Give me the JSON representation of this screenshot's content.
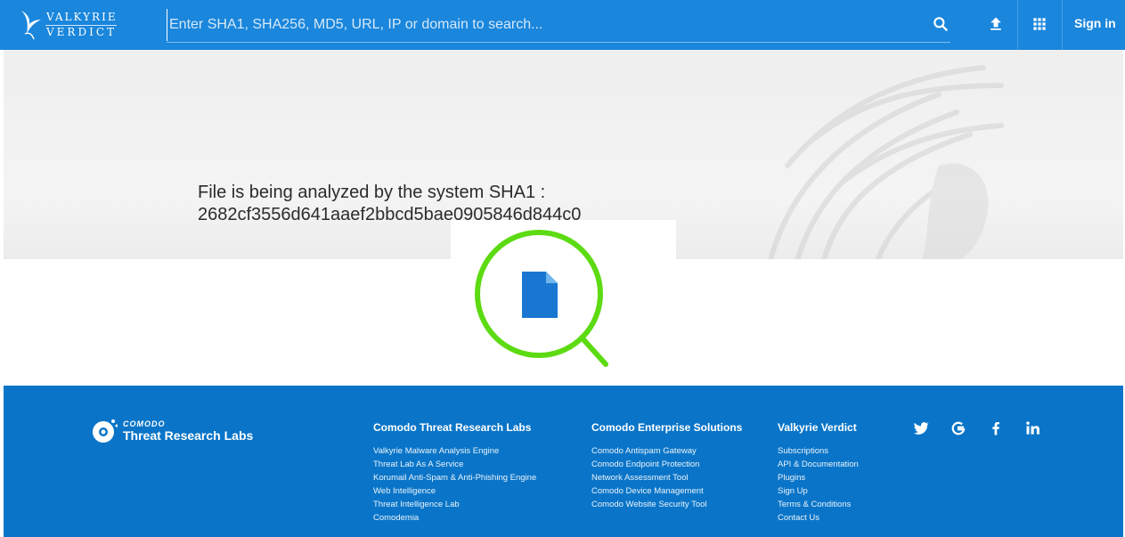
{
  "header": {
    "logo_line1": "VALKYRIE",
    "logo_line2": "VERDICT",
    "search_placeholder": "Enter SHA1, SHA256, MD5, URL, IP or domain to search...",
    "icons": [
      "search-icon",
      "upload-icon",
      "apps-grid-icon"
    ],
    "signin_label": "Sign in",
    "bg_color": "#1a86dc"
  },
  "main": {
    "message_line1": "File is being analyzed by the system SHA1 :",
    "message_line2": "2682cf3556d641aaef2bbcd5bae0905846d844c0",
    "magnifier_color": "#5ddb12",
    "file_icon_color": "#1977d1"
  },
  "footer": {
    "bg_color": "#0a75c8",
    "logo_small": "COMODO",
    "logo_big": "Threat Research Labs",
    "columns": [
      {
        "title": "Comodo Threat Research Labs",
        "items": [
          "Valkyrie Malware Analysis Engine",
          "Threat Lab As A Service",
          "Korumail Anti-Spam & Anti-Phishing Engine",
          "Web Intelligence",
          "Threat Intelligence Lab",
          "Comodemia"
        ]
      },
      {
        "title": "Comodo Enterprise Solutions",
        "items": [
          "Comodo Antispam Gateway",
          "Comodo Endpoint Protection",
          "Network Assessment Tool",
          "Comodo Device Management",
          "Comodo Website Security Tool"
        ]
      },
      {
        "title": "Valkyrie Verdict",
        "items": [
          "Subscriptions",
          "API & Documentation",
          "Plugins",
          "Sign Up",
          "Terms & Conditions",
          "Contact Us"
        ]
      }
    ],
    "social": [
      "twitter-icon",
      "google-icon",
      "facebook-icon",
      "linkedin-icon"
    ]
  }
}
